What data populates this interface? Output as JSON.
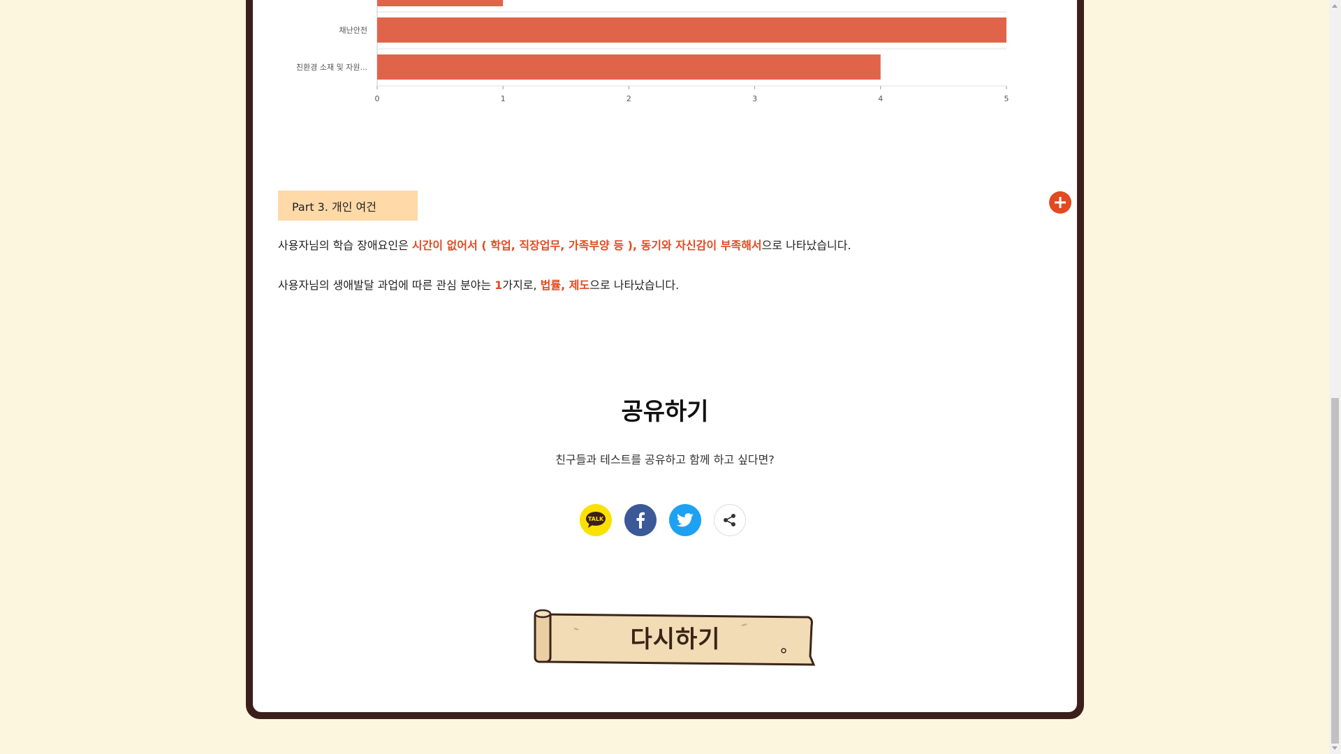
{
  "chart_data": {
    "type": "bar",
    "orientation": "horizontal",
    "categories": [
      "채난안전",
      "친환경 소재 및 자원..."
    ],
    "values": [
      5,
      4
    ],
    "partial_bar_above_value": 1,
    "xlim": [
      0,
      5
    ],
    "xticks": [
      "0",
      "1",
      "2",
      "3",
      "4",
      "5"
    ],
    "grid": true,
    "bar_color": "#e0644a"
  },
  "part3": {
    "header": "Part 3. 개인 여건",
    "expand_icon": "plus-icon",
    "line1": {
      "prefix": "사용자님의 학습 장애요인은 ",
      "highlight": "시간이 없어서 ( 학업, 직장업무, 가족부양 등 ), 동기와 자신감이 부족해서",
      "suffix": "으로 나타났습니다."
    },
    "line2": {
      "prefix": "사용자님의 생애발달 과업에 따른 관심 분야는 ",
      "count": "1",
      "middle": "가지로, ",
      "highlight": "법률, 제도",
      "suffix": "으로 나타났습니다."
    }
  },
  "share": {
    "title": "공유하기",
    "subtitle": "친구들과 테스트를 공유하고 함께 하고 싶다면?",
    "kakao_label": "TALK",
    "icons": [
      "kakao-talk-icon",
      "facebook-icon",
      "twitter-icon",
      "share-icon"
    ]
  },
  "retry": {
    "label": "다시하기"
  },
  "colors": {
    "background": "#fdf6df",
    "frame": "#3c1f1a",
    "accent": "#e24a21",
    "part_header_bg": "#ffd9a8"
  }
}
